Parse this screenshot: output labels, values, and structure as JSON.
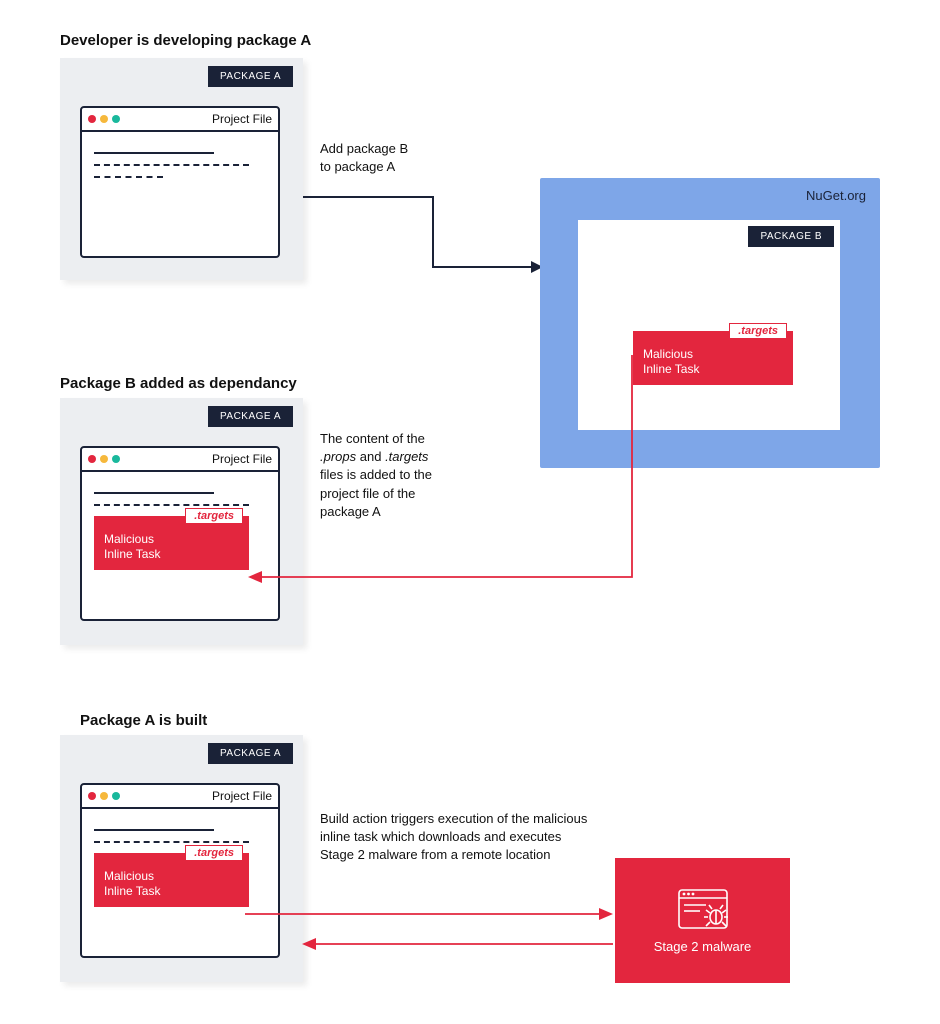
{
  "step1": {
    "heading": "Developer is developing package A",
    "package_tag": "PACKAGE A",
    "project_title": "Project File"
  },
  "arrow1_label": "Add package B\nto package A",
  "nuget": {
    "label": "NuGet.org",
    "package_tag": "PACKAGE B",
    "malicious_label": "Malicious\nInline Task",
    "targets": ".targets"
  },
  "step2": {
    "heading": "Package B added as dependancy",
    "package_tag": "PACKAGE A",
    "project_title": "Project File",
    "malicious_label": "Malicious\nInline Task",
    "targets": ".targets"
  },
  "arrow2_label": "The content of the .props and .targets files is added to the project file of the package A",
  "step3": {
    "heading": "Package A is built",
    "package_tag": "PACKAGE A",
    "project_title": "Project File",
    "malicious_label": "Malicious\nInline Task",
    "targets": ".targets"
  },
  "arrow3_label": "Build action triggers execution of the malicious inline task which downloads and executes Stage 2 malware from a remote location",
  "stage2": {
    "label": "Stage 2 malware"
  }
}
